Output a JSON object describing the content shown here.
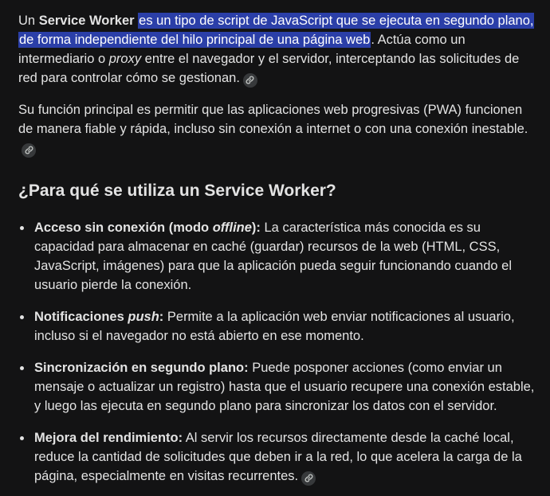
{
  "intro": {
    "p1_prefix": "Un ",
    "p1_bold": "Service Worker",
    "p1_highlight": "es un tipo de script de JavaScript que se ejecuta en segundo plano, de forma independiente del hilo principal de una página web",
    "p1_mid": ". Actúa como un intermediario o ",
    "p1_italic": "proxy",
    "p1_suffix": " entre el navegador y el servidor, interceptando las solicitudes de red para controlar cómo se gestionan.",
    "p2": "Su función principal es permitir que las aplicaciones web progresivas (PWA) funcionen de manera fiable y rápida, incluso sin conexión a internet o con una conexión inestable."
  },
  "section": {
    "heading": "¿Para qué se utiliza un Service Worker?",
    "items": [
      {
        "title_a": "Acceso sin conexión (modo ",
        "title_italic": "offline",
        "title_b": "):",
        "text": " La característica más conocida es su capacidad para almacenar en caché (guardar) recursos de la web (HTML, CSS, JavaScript, imágenes) para que la aplicación pueda seguir funcionando cuando el usuario pierde la conexión."
      },
      {
        "title_a": "Notificaciones ",
        "title_italic": "push",
        "title_b": ":",
        "text": " Permite a la aplicación web enviar notificaciones al usuario, incluso si el navegador no está abierto en ese momento."
      },
      {
        "title_a": "Sincronización en segundo plano:",
        "text": " Puede posponer acciones (como enviar un mensaje o actualizar un registro) hasta que el usuario recupere una conexión estable, y luego las ejecuta en segundo plano para sincronizar los datos con el servidor."
      },
      {
        "title_a": "Mejora del rendimiento:",
        "text": " Al servir los recursos directamente desde la caché local, reduce la cantidad de solicitudes que deben ir a la red, lo que acelera la carga de la página, especialmente en visitas recurrentes."
      }
    ]
  },
  "icons": {
    "source_link": "link-icon"
  },
  "colors": {
    "background": "#131314",
    "text": "#e3e3e3",
    "highlight": "#2b3fa8",
    "chip": "#37393b"
  }
}
